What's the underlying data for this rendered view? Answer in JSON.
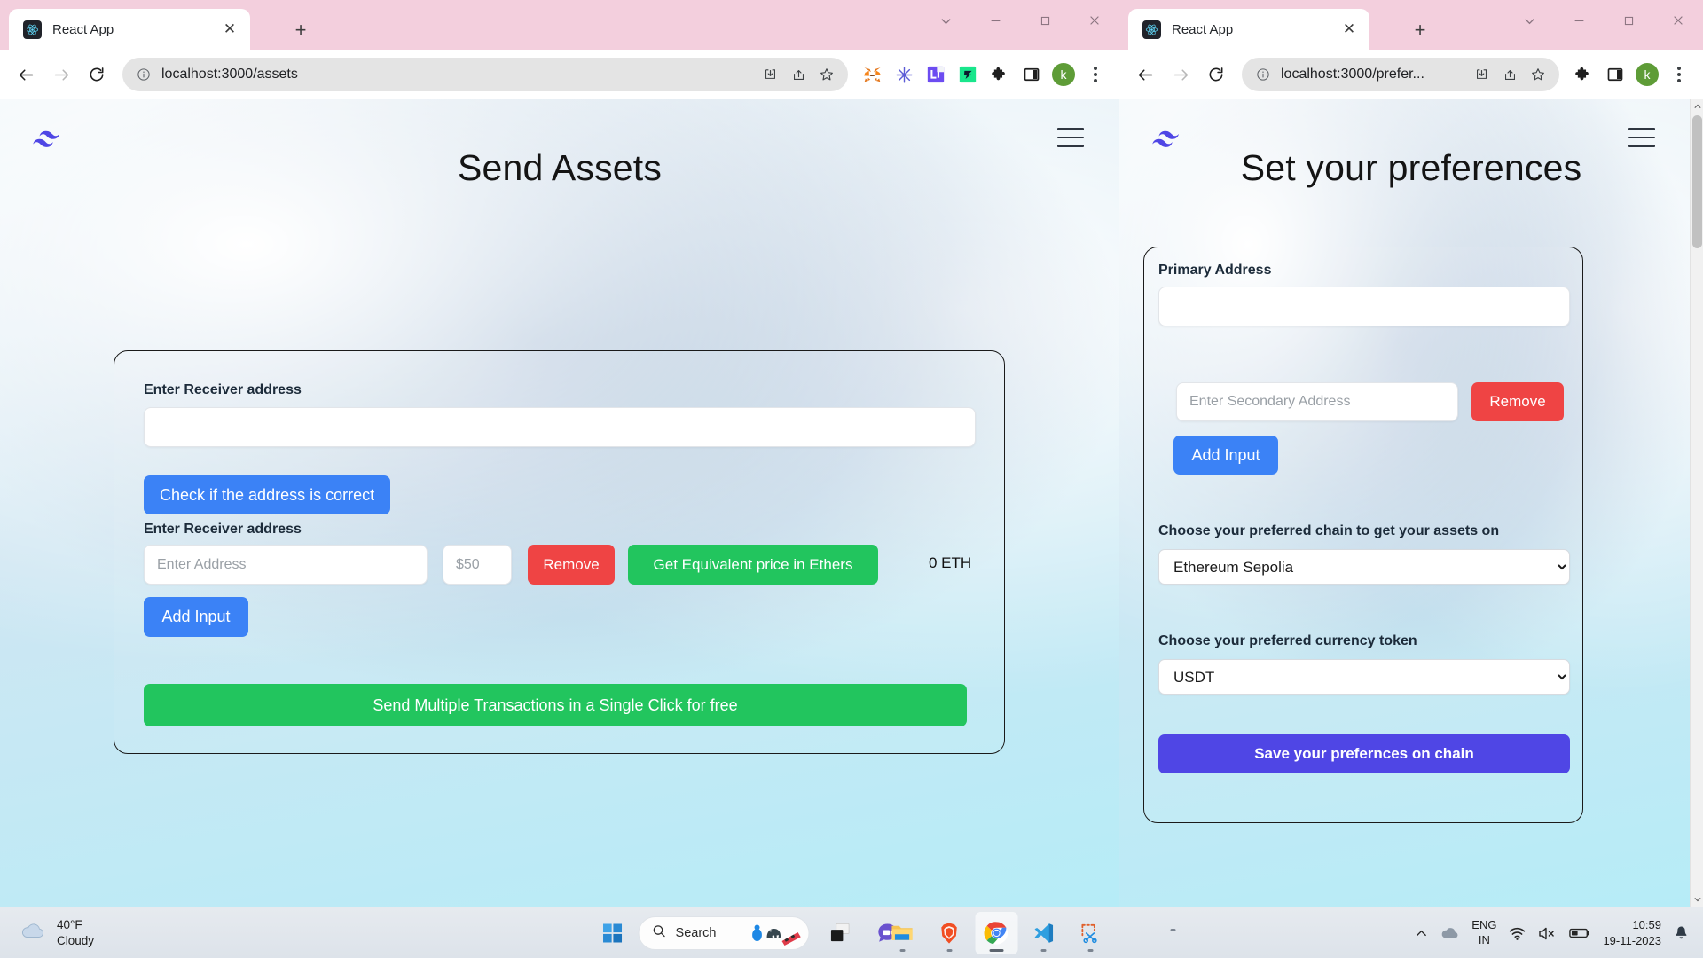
{
  "windows": {
    "left": {
      "tab": {
        "title": "React App",
        "favicon": "react-logo-icon",
        "close": "✕"
      },
      "new_tab": "+",
      "controls": {
        "minimize": "—",
        "maximize": "□",
        "close": "✕"
      },
      "omnibox": {
        "url": "localhost:3000/assets",
        "info_icon": "info-circle-icon",
        "actions": [
          "install-icon",
          "share-icon",
          "bookmark-star-icon"
        ]
      },
      "extensions": [
        "metamask-fox-icon",
        "blue-snowflake-icon",
        "purple-li-icon",
        "green-flash-icon",
        "puzzle-piece-icon",
        "sidepanel-icon"
      ],
      "profile_initial": "k",
      "page": {
        "logo": "tailwind-wave-logo",
        "menu_icon": "hamburger-menu-icon",
        "title": "Send Assets",
        "receiver_label_top": "Enter Receiver address",
        "receiver_value_top": "",
        "check_address_button": "Check if the address is correct",
        "receiver_label_row": "Enter Receiver address",
        "address_placeholder": "Enter Address",
        "address_value": "",
        "amount_placeholder": "$50",
        "amount_value": "",
        "remove_button": "Remove",
        "get_price_button": "Get Equivalent price in Ethers",
        "eth_amount": "0 ETH",
        "add_input_button": "Add Input",
        "send_button": "Send Multiple Transactions in a Single Click for free"
      }
    },
    "right": {
      "tab": {
        "title": "React App",
        "favicon": "react-logo-icon",
        "close": "✕"
      },
      "new_tab": "+",
      "controls": {
        "minimize": "—",
        "maximize": "□",
        "close": "✕"
      },
      "omnibox": {
        "url": "localhost:3000/prefer...",
        "info_icon": "info-circle-icon",
        "actions": [
          "install-icon",
          "share-icon",
          "bookmark-star-icon"
        ]
      },
      "extensions": [
        "puzzle-piece-icon",
        "sidepanel-icon"
      ],
      "profile_initial": "k",
      "page": {
        "logo": "tailwind-wave-logo",
        "menu_icon": "hamburger-menu-icon",
        "title": "Set your preferences",
        "primary_address_label": "Primary Address",
        "primary_address_value": "",
        "secondary_address_placeholder": "Enter Secondary Address",
        "secondary_address_value": "",
        "remove_button": "Remove",
        "add_input_button": "Add Input",
        "chain_label": "Choose your preferred chain to get your assets on",
        "chain_selected": "Ethereum Sepolia",
        "chain_options": [
          "Ethereum Sepolia"
        ],
        "currency_label": "Choose your preferred currency token",
        "currency_selected": "USDT",
        "currency_options": [
          "USDT"
        ],
        "save_button": "Save your prefernces on chain"
      }
    }
  },
  "taskbar": {
    "weather": {
      "temperature": "40°F",
      "condition": "Cloudy",
      "icon": "cloud-icon"
    },
    "start_icon": "windows-start-icon",
    "search_placeholder": "Search",
    "search_icon": "search-icon",
    "items": [
      {
        "name": "task-view",
        "label": "Task View"
      },
      {
        "name": "teams-chat",
        "label": "Chat"
      },
      {
        "name": "file-explorer",
        "label": "File Explorer"
      },
      {
        "name": "brave-browser",
        "label": "Brave"
      },
      {
        "name": "google-chrome",
        "label": "Google Chrome"
      },
      {
        "name": "vs-code",
        "label": "Visual Studio Code"
      },
      {
        "name": "snipping-tool",
        "label": "Snipping Tool"
      }
    ],
    "tray": {
      "overflow_icon": "chevron-up-icon",
      "onedrive_icon": "cloud-icon",
      "language_primary": "ENG",
      "language_secondary": "IN",
      "wifi_icon": "wifi-icon",
      "volume_icon": "volume-muted-icon",
      "battery_icon": "battery-icon",
      "time": "10:59",
      "date": "19-11-2023",
      "notification_icon": "bell-icon"
    }
  },
  "colors": {
    "accent_blue": "#3b82f6",
    "danger_red": "#ef4444",
    "success_green": "#22c55e",
    "indigo": "#4f46e5",
    "tab_pink": "#f3cfdd"
  }
}
